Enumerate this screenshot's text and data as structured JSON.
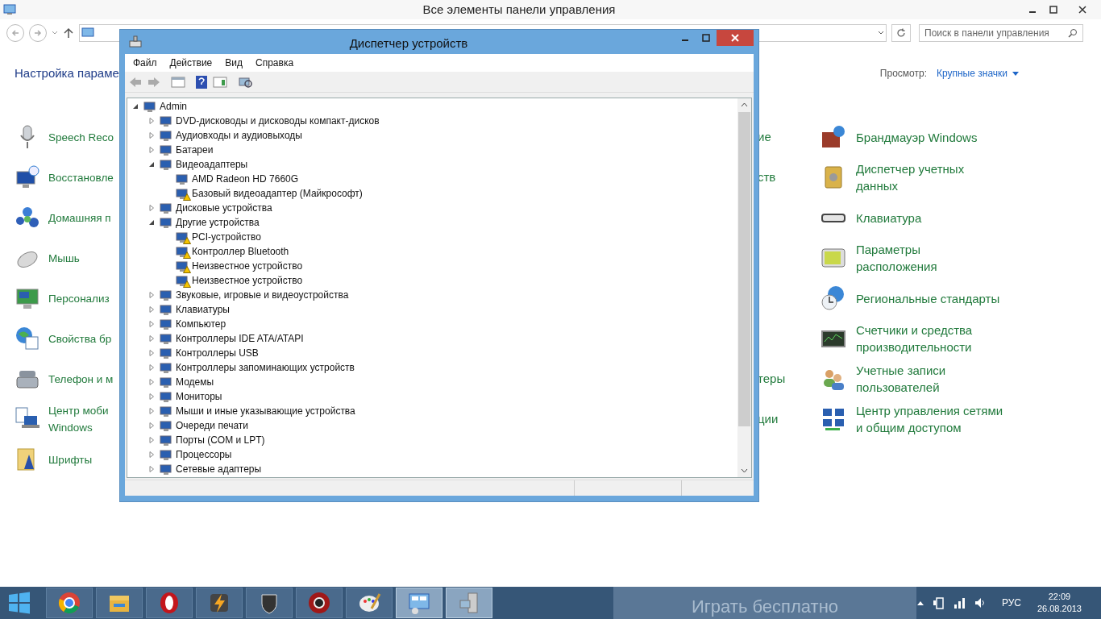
{
  "control_panel": {
    "title": "Все элементы панели управления",
    "search": {
      "placeholder": "Поиск в панели управления"
    },
    "heading": "Настройка параме",
    "view_label": "Просмотр:",
    "view_value": "Крупные значки",
    "items_left": [
      {
        "label": "Speech Reco"
      },
      {
        "label": "Восстановле"
      },
      {
        "label": "Домашняя п"
      },
      {
        "label": "Мышь"
      },
      {
        "label": "Персонализ"
      },
      {
        "label": "Свойства бр"
      },
      {
        "label": "Телефон и м"
      },
      {
        "label": "Центр моби\nWindows"
      },
      {
        "label": "Шрифты"
      }
    ],
    "items_middle": [
      {
        "label": "ие"
      },
      {
        "label": "ств"
      },
      {
        "label": "теры"
      },
      {
        "label": "ции"
      }
    ],
    "items_right": [
      {
        "label": "Брандмауэр Windows"
      },
      {
        "label": "Диспетчер учетных\nданных"
      },
      {
        "label": "Клавиатура"
      },
      {
        "label": "Параметры\nрасположения"
      },
      {
        "label": "Региональные стандарты"
      },
      {
        "label": "Счетчики и средства\nпроизводительности"
      },
      {
        "label": "Учетные записи\nпользователей"
      },
      {
        "label": "Центр управления сетями\nи общим доступом"
      }
    ]
  },
  "device_manager": {
    "title": "Диспетчер устройств",
    "menu": [
      "Файл",
      "Действие",
      "Вид",
      "Справка"
    ],
    "tree": {
      "label": "Admin",
      "expanded": true,
      "children": [
        {
          "label": "DVD-дисководы и дисководы компакт-дисков",
          "expanded": false
        },
        {
          "label": "Аудиовходы и аудиовыходы",
          "expanded": false
        },
        {
          "label": "Батареи",
          "expanded": false
        },
        {
          "label": "Видеоадаптеры",
          "expanded": true,
          "children": [
            {
              "label": "AMD Radeon HD 7660G",
              "warning": false
            },
            {
              "label": "Базовый видеоадаптер (Майкрософт)",
              "warning": true
            }
          ]
        },
        {
          "label": "Дисковые устройства",
          "expanded": false
        },
        {
          "label": "Другие устройства",
          "expanded": true,
          "children": [
            {
              "label": "PCI-устройство",
              "warning": true
            },
            {
              "label": "Контроллер Bluetooth",
              "warning": true
            },
            {
              "label": "Неизвестное устройство",
              "warning": true
            },
            {
              "label": "Неизвестное устройство",
              "warning": true
            }
          ]
        },
        {
          "label": "Звуковые, игровые и видеоустройства",
          "expanded": false
        },
        {
          "label": "Клавиатуры",
          "expanded": false
        },
        {
          "label": "Компьютер",
          "expanded": false
        },
        {
          "label": "Контроллеры IDE ATA/ATAPI",
          "expanded": false
        },
        {
          "label": "Контроллеры USB",
          "expanded": false
        },
        {
          "label": "Контроллеры запоминающих устройств",
          "expanded": false
        },
        {
          "label": "Модемы",
          "expanded": false
        },
        {
          "label": "Мониторы",
          "expanded": false
        },
        {
          "label": "Мыши и иные указывающие устройства",
          "expanded": false
        },
        {
          "label": "Очереди печати",
          "expanded": false
        },
        {
          "label": "Порты (COM и LPT)",
          "expanded": false
        },
        {
          "label": "Процессоры",
          "expanded": false
        },
        {
          "label": "Сетевые адаптеры",
          "expanded": false
        }
      ]
    }
  },
  "taskbar": {
    "apps": [
      {
        "running": false
      },
      {
        "running": false
      },
      {
        "running": false
      },
      {
        "running": false
      },
      {
        "running": false
      },
      {
        "running": false
      },
      {
        "running": false
      },
      {
        "running": true
      },
      {
        "running": true
      }
    ],
    "ad_text": "Играть бесплатно",
    "language": "РУС",
    "time": "22:09",
    "date": "26.08.2013"
  }
}
